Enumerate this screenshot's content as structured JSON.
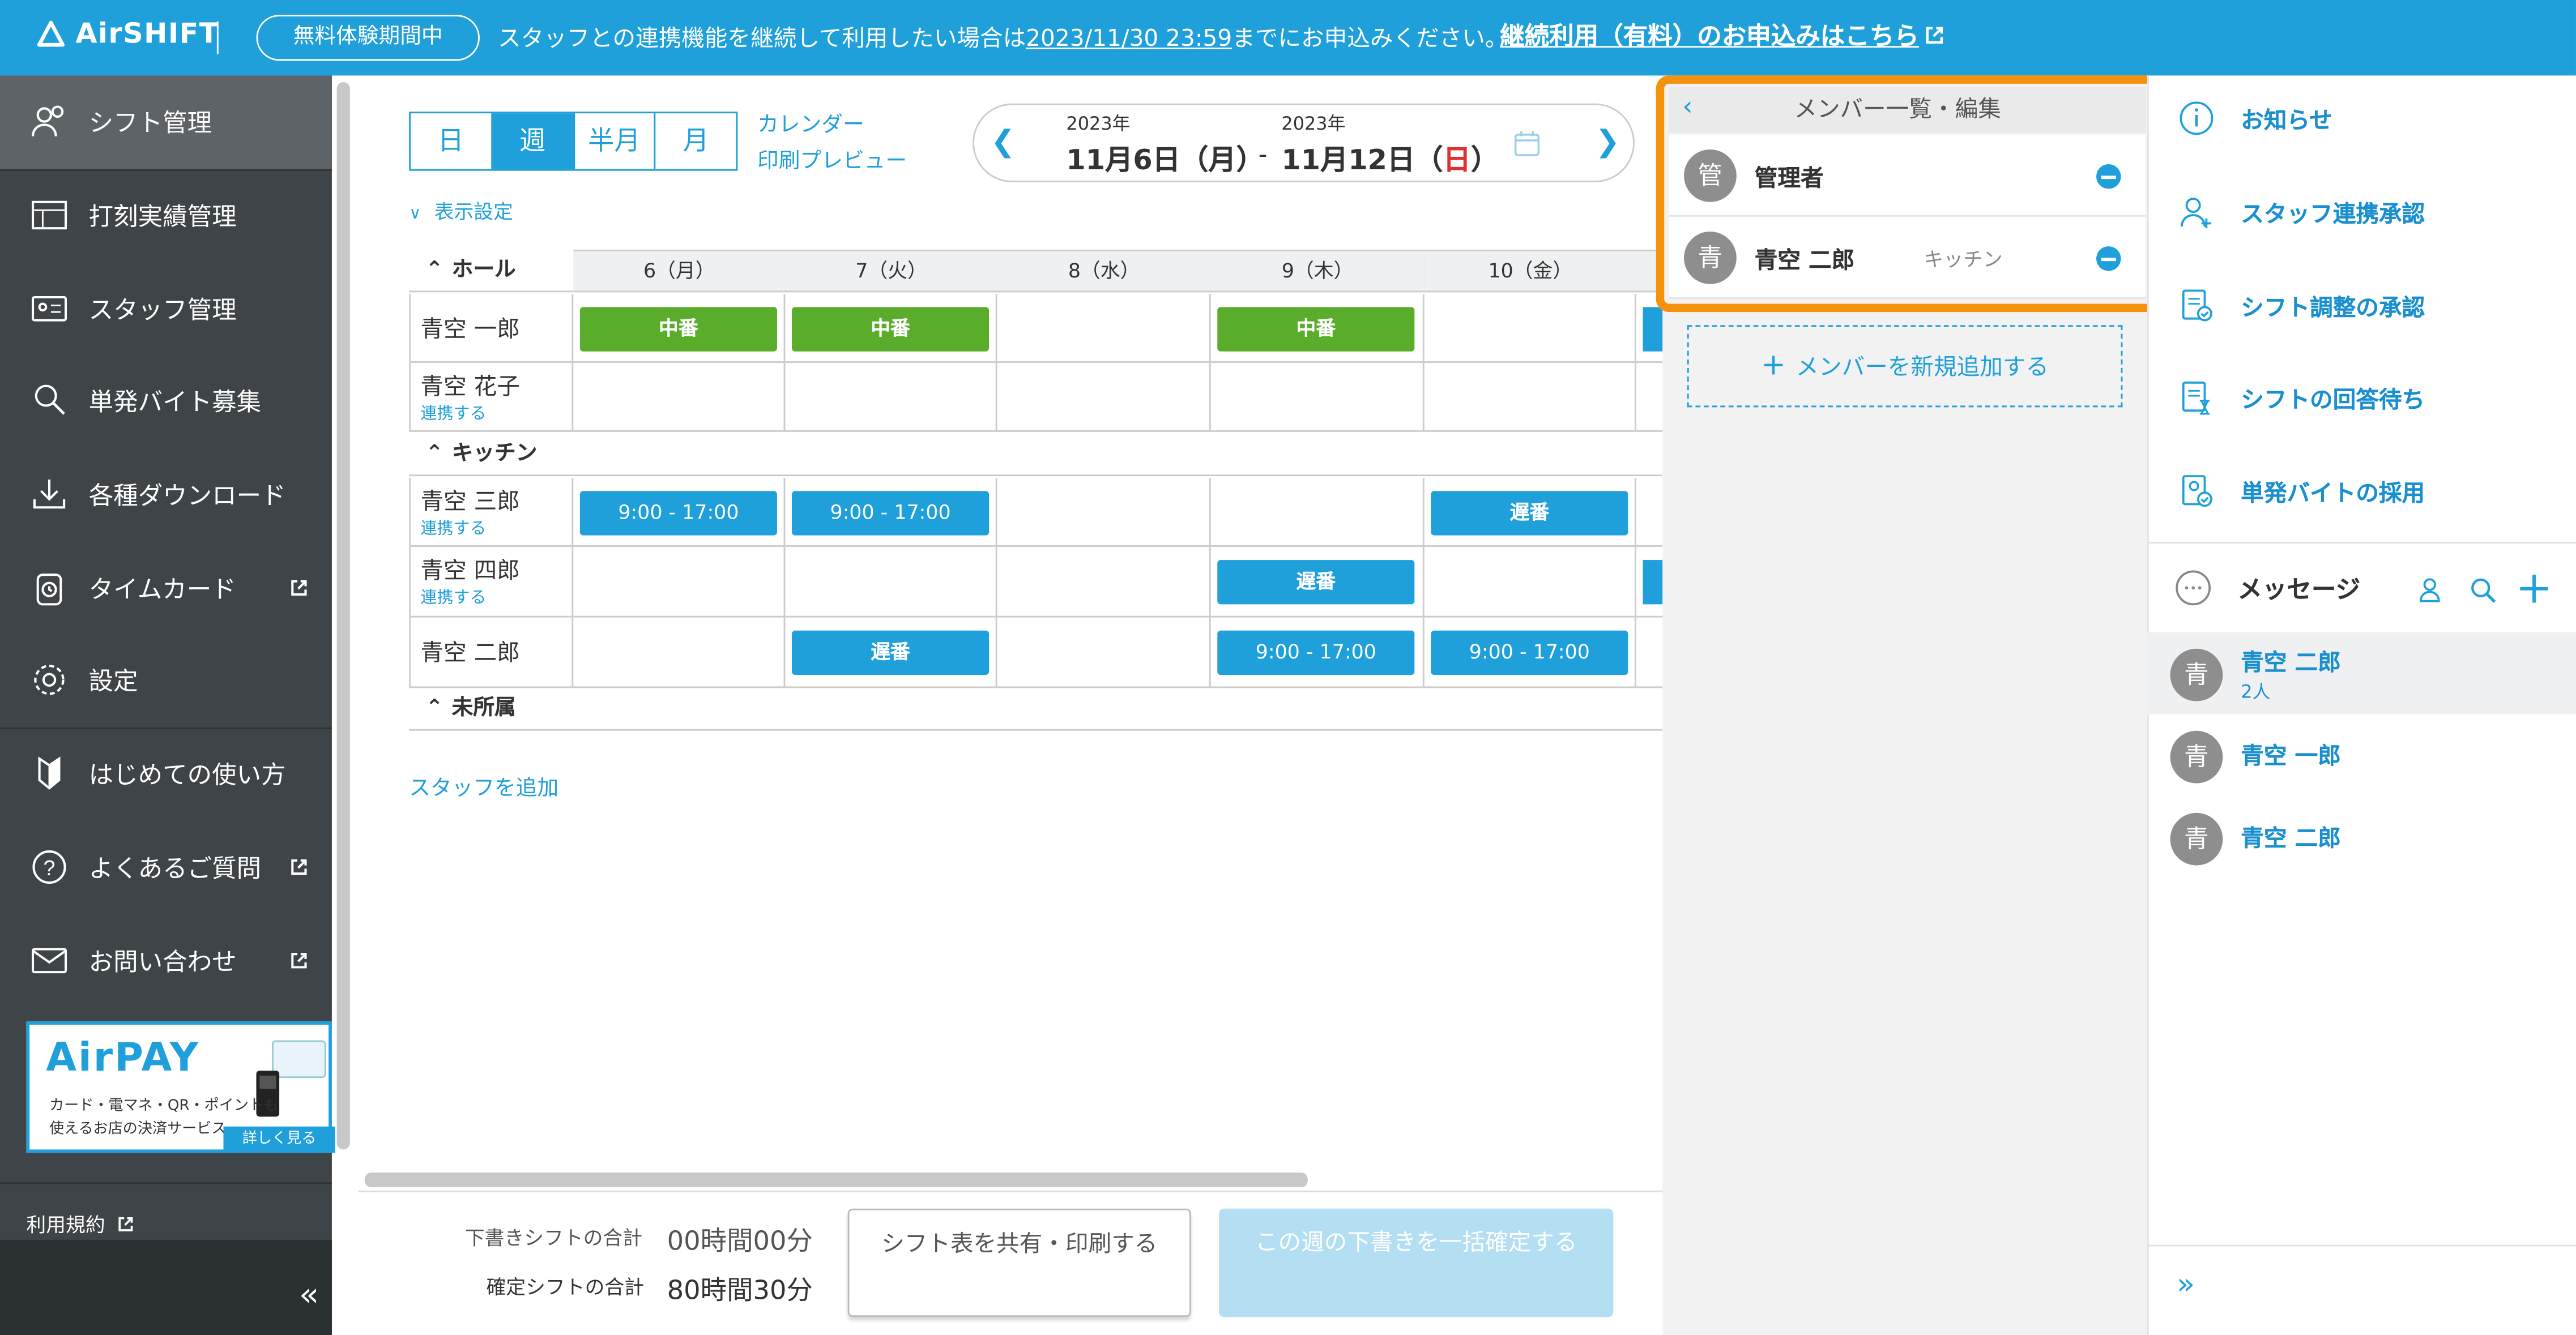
{
  "banner": {
    "logo": "AirSHIFT",
    "trial_badge": "無料体験期間中",
    "message_pre": "スタッフとの連携機能を継続して利用したい場合は",
    "message_date": "2023/11/30 23:59",
    "message_post": "までにお申込みください。",
    "link": "継続利用（有料）のお申込みはこちら"
  },
  "sidebar": {
    "items": [
      {
        "label": "シフト管理",
        "icon": "calendar-people-icon",
        "external": false
      },
      {
        "label": "打刻実績管理",
        "icon": "table-icon",
        "external": false
      },
      {
        "label": "スタッフ管理",
        "icon": "id-card-icon",
        "external": false
      },
      {
        "label": "単発バイト募集",
        "icon": "person-search-icon",
        "external": false
      },
      {
        "label": "各種ダウンロード",
        "icon": "download-icon",
        "external": false
      },
      {
        "label": "タイムカード",
        "icon": "timecard-icon",
        "external": true
      },
      {
        "label": "設定",
        "icon": "gear-icon",
        "external": false
      },
      {
        "label": "はじめての使い方",
        "icon": "beginner-icon",
        "external": false
      },
      {
        "label": "よくあるご質問",
        "icon": "question-icon",
        "external": true
      },
      {
        "label": "お問い合わせ",
        "icon": "mail-icon",
        "external": true
      }
    ],
    "airpay": {
      "logo": "AirPAY",
      "line1": "カード・電マネ・QR・ポイントも",
      "line2": "使えるお店の決済サービス",
      "more": "詳しく見る"
    },
    "terms": "利用規約",
    "collapse": "«"
  },
  "toolbar": {
    "view_tabs": [
      "日",
      "週",
      "半月",
      "月"
    ],
    "selected_tab": "週",
    "calendar_preview_line1": "カレンダー",
    "calendar_preview_line2": "印刷プレビュー",
    "start_year": "2023年",
    "end_year": "2023年",
    "start_date": "11月6日（月）",
    "range_sep": "-",
    "end_date_pre": "11月12日（",
    "end_date_day": "日",
    "end_date_post": "）",
    "display_settings": "表示設定"
  },
  "schedule": {
    "days": [
      "6（月）",
      "7（火）",
      "8（水）",
      "9（木）",
      "10（金）"
    ],
    "groups": [
      {
        "name": "ホール",
        "rows": [
          {
            "name": "青空 一郎",
            "link": "",
            "shifts": [
              "中番",
              "中番",
              "",
              "中番",
              ""
            ]
          },
          {
            "name": "青空 花子",
            "link": "連携する",
            "shifts": [
              "",
              "",
              "",
              "",
              ""
            ]
          }
        ]
      },
      {
        "name": "キッチン",
        "rows": [
          {
            "name": "青空 三郎",
            "link": "連携する",
            "shifts": [
              "9:00 - 17:00",
              "9:00 - 17:00",
              "",
              "",
              "遅番"
            ]
          },
          {
            "name": "青空 四郎",
            "link": "連携する",
            "shifts": [
              "",
              "",
              "",
              "遅番",
              ""
            ]
          },
          {
            "name": "青空 二郎",
            "link": "",
            "shifts": [
              "",
              "遅番",
              "",
              "9:00 - 17:00",
              "9:00 - 17:00"
            ]
          }
        ]
      },
      {
        "name": "未所属",
        "rows": []
      }
    ],
    "add_staff": "スタッフを追加"
  },
  "footer": {
    "draft_label": "下書きシフトの合計",
    "draft_value": "00時間00分",
    "confirmed_label": "確定シフトの合計",
    "confirmed_value": "80時間30分",
    "share_button": "シフト表を共有・印刷する",
    "confirm_button": "この週の下書きを一括確定する"
  },
  "member_panel": {
    "title": "メンバー一覧・編集",
    "members": [
      {
        "avatar": "管",
        "name": "管理者",
        "group": ""
      },
      {
        "avatar": "青",
        "name": "青空 二郎",
        "group": "キッチン"
      }
    ],
    "add_member": "メンバーを新規追加する"
  },
  "right_panel": {
    "items": [
      {
        "label": "お知らせ",
        "icon": "info-icon"
      },
      {
        "label": "スタッフ連携承認",
        "icon": "person-add-icon"
      },
      {
        "label": "シフト調整の承認",
        "icon": "doc-check-icon"
      },
      {
        "label": "シフトの回答待ち",
        "icon": "doc-hourglass-icon"
      },
      {
        "label": "単発バイトの採用",
        "icon": "person-doc-icon"
      }
    ],
    "messages_title": "メッセージ",
    "threads": [
      {
        "avatar": "青",
        "name": "青空 二郎",
        "sub": "2人"
      },
      {
        "avatar": "青",
        "name": "青空 一郎",
        "sub": ""
      },
      {
        "avatar": "青",
        "name": "青空 二郎",
        "sub": ""
      }
    ],
    "expand": "»"
  },
  "colors": {
    "brand_blue": "#1fa0da",
    "sidebar": "#3e4447",
    "shift_green": "#5aad2b",
    "highlight_orange": "#f5920d",
    "sunday_red": "#e03030"
  }
}
